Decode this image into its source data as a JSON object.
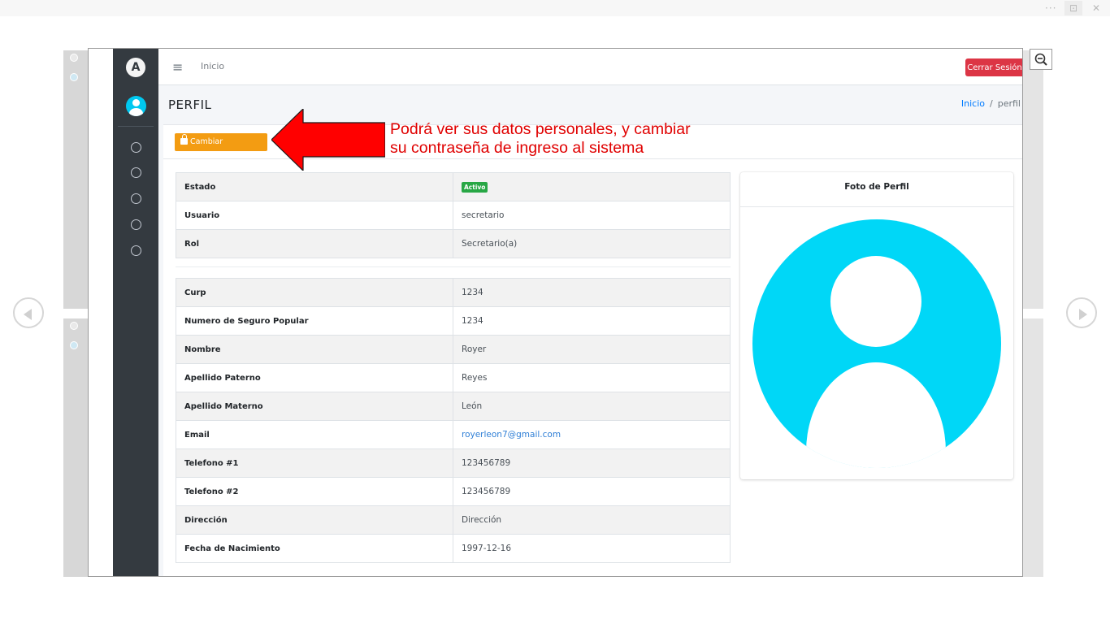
{
  "viewer": {
    "dots": "···",
    "fit_icon": "fit-screen-icon",
    "close_icon": "close-icon",
    "prev_icon": "arrow-left-icon",
    "next_icon": "arrow-right-icon",
    "zoom_icon": "zoom-out-icon"
  },
  "sidebar": {
    "logo_letter": "A",
    "menu_icons": [
      "circle-icon",
      "circle-icon",
      "circle-icon",
      "circle-icon",
      "circle-icon"
    ]
  },
  "topnav": {
    "menu_icon": "≡",
    "home_link": "Inicio",
    "logout_label": "Cerrar Sesión"
  },
  "page": {
    "title": "PERFIL",
    "breadcrumb": {
      "home": "Inicio",
      "separator": "/",
      "current": "perfil"
    }
  },
  "actions": {
    "change_password_label": "Cambiar contraseña"
  },
  "account_table": [
    {
      "key": "Estado",
      "value": "Activo",
      "badge": true
    },
    {
      "key": "Usuario",
      "value": "secretario"
    },
    {
      "key": "Rol",
      "value": "Secretario(a)"
    }
  ],
  "personal_table": [
    {
      "key": "Curp",
      "value": "1234"
    },
    {
      "key": "Numero de Seguro Popular",
      "value": "1234"
    },
    {
      "key": "Nombre",
      "value": "Royer"
    },
    {
      "key": "Apellido Paterno",
      "value": "Reyes"
    },
    {
      "key": "Apellido Materno",
      "value": "León"
    },
    {
      "key": "Email",
      "value": "royerleon7@gmail.com",
      "link": true
    },
    {
      "key": "Telefono #1",
      "value": "123456789"
    },
    {
      "key": "Telefono #2",
      "value": "123456789"
    },
    {
      "key": "Dirección",
      "value": "Dirección"
    },
    {
      "key": "Fecha de Nacimiento",
      "value": "1997-12-16"
    }
  ],
  "photo": {
    "title": "Foto de Perfil",
    "avatar_color": "#00d7f7"
  },
  "annotation": {
    "line1": "Podrá ver sus datos personales, y cambiar",
    "line2": "su contraseña de ingreso al sistema",
    "color": "#e00000"
  },
  "colors": {
    "sidebar": "#343a40",
    "danger": "#dc3545",
    "warning": "#f39c12",
    "success": "#28a745",
    "link": "#007bff"
  }
}
